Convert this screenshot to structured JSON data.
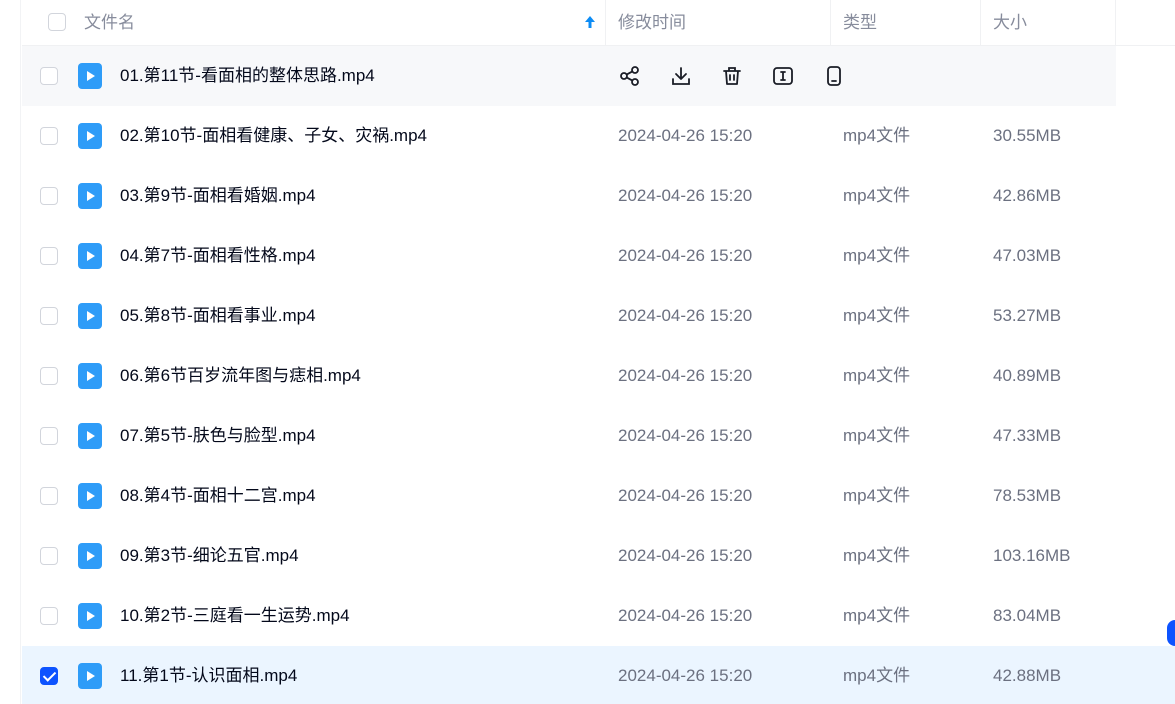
{
  "header": {
    "col_name": "文件名",
    "col_time": "修改时间",
    "col_type": "类型",
    "col_size": "大小"
  },
  "icons": {
    "sort": "arrow-up-icon",
    "file": "video-play-file-icon",
    "share": "share-icon",
    "download": "download-icon",
    "delete": "trash-icon",
    "rename": "rename-icon",
    "mobile": "mobile-phone-icon"
  },
  "colors": {
    "accent": "#0d53ff",
    "file_icon": "#2e9cf8",
    "selected_row": "#ebf5ff",
    "hover_row": "#f7f8fa"
  },
  "rows": [
    {
      "name": "01.第11节-看面相的整体思路.mp4",
      "time": "",
      "type": "",
      "size": "",
      "checked": false,
      "hover": true
    },
    {
      "name": "02.第10节-面相看健康、子女、灾祸.mp4",
      "time": "2024-04-26 15:20",
      "type": "mp4文件",
      "size": "30.55MB",
      "checked": false
    },
    {
      "name": "03.第9节-面相看婚姻.mp4",
      "time": "2024-04-26 15:20",
      "type": "mp4文件",
      "size": "42.86MB",
      "checked": false
    },
    {
      "name": "04.第7节-面相看性格.mp4",
      "time": "2024-04-26 15:20",
      "type": "mp4文件",
      "size": "47.03MB",
      "checked": false
    },
    {
      "name": "05.第8节-面相看事业.mp4",
      "time": "2024-04-26 15:20",
      "type": "mp4文件",
      "size": "53.27MB",
      "checked": false
    },
    {
      "name": "06.第6节百岁流年图与痣相.mp4",
      "time": "2024-04-26 15:20",
      "type": "mp4文件",
      "size": "40.89MB",
      "checked": false
    },
    {
      "name": "07.第5节-肤色与脸型.mp4",
      "time": "2024-04-26 15:20",
      "type": "mp4文件",
      "size": "47.33MB",
      "checked": false
    },
    {
      "name": "08.第4节-面相十二宫.mp4",
      "time": "2024-04-26 15:20",
      "type": "mp4文件",
      "size": "78.53MB",
      "checked": false
    },
    {
      "name": "09.第3节-细论五官.mp4",
      "time": "2024-04-26 15:20",
      "type": "mp4文件",
      "size": "103.16MB",
      "checked": false
    },
    {
      "name": "10.第2节-三庭看一生运势.mp4",
      "time": "2024-04-26 15:20",
      "type": "mp4文件",
      "size": "83.04MB",
      "checked": false
    },
    {
      "name": "11.第1节-认识面相.mp4",
      "time": "2024-04-26 15:20",
      "type": "mp4文件",
      "size": "42.88MB",
      "checked": true
    }
  ]
}
